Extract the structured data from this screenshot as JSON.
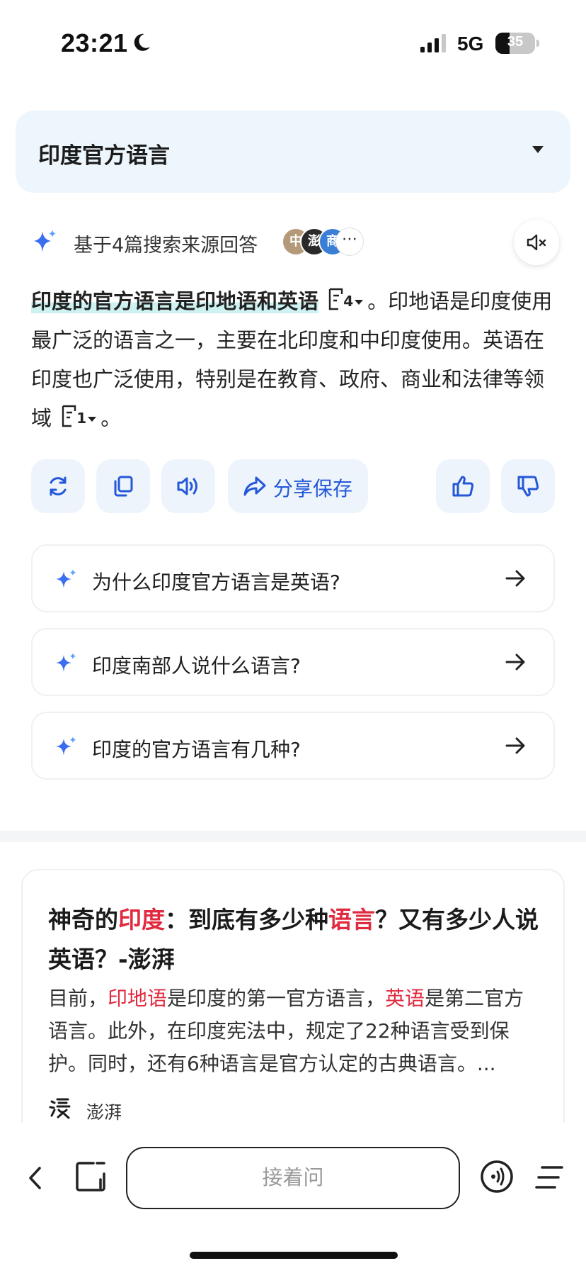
{
  "status_bar": {
    "time": "23:21",
    "network": "5G",
    "battery_level": "35",
    "battery_fraction": 0.35
  },
  "query": {
    "title": "印度官方语言"
  },
  "answer": {
    "source_text": "基于4篇搜索来源回答",
    "source_avatars": [
      {
        "label": "中",
        "color": "#b59a7a"
      },
      {
        "label": "澎",
        "color": "#2a2a2a"
      },
      {
        "label": "商",
        "color": "#3a7fd5"
      }
    ],
    "more_label": "⋯",
    "highlight": "印度的官方语言是印地语和英语",
    "cite1": "4",
    "segment1": "。印地语是印度使用最广泛的语言之一，主要在北印度和中印度使用。英语在印度也广泛使用，特别是在教育、政府、商业和法律等领域",
    "cite2": "1",
    "segment2": "。"
  },
  "actions": {
    "share_label": "分享保存"
  },
  "suggestions": [
    {
      "text": "为什么印度官方语言是英语?"
    },
    {
      "text": "印度南部人说什么语言?"
    },
    {
      "text": "印度的官方语言有几种?"
    }
  ],
  "article": {
    "title_parts": [
      "神奇的",
      "印度",
      "：到底有多少种",
      "语言",
      "？又有多少人说英语？-澎湃"
    ],
    "body_parts": [
      "目前，",
      "印地语",
      "是印度的第一官方语言，",
      "英语",
      "是第二官方语言。此外，在印度宪法中，规定了22种语言受到保护。同时，还有6种语言是官方认定的古典语言。..."
    ],
    "source": "澎湃",
    "highlight_color": "#e02a3f"
  },
  "bottom_bar": {
    "input_placeholder": "接着问"
  },
  "colors": {
    "accent": "#2458d8",
    "query_bg": "#eef6fd",
    "action_bg": "#eef4fc"
  }
}
